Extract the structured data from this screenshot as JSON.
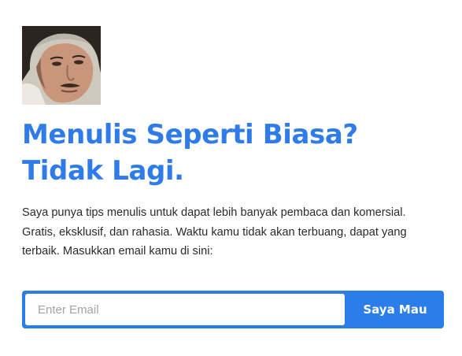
{
  "profile": {
    "photo_icon": "portrait-photo"
  },
  "headline": {
    "line1": "Menulis Seperti Biasa?",
    "line2": "Tidak Lagi."
  },
  "description": {
    "line1": "Saya punya tips menulis untuk dapat lebih banyak pembaca dan komersial.",
    "line2": "Gratis, eksklusif, dan rahasia. Waktu kamu tidak akan terbuang, dapat yang",
    "line3": "terbaik. Masukkan email kamu di sini:"
  },
  "form": {
    "email_placeholder": "Enter Email",
    "email_value": "",
    "submit_label": "Saya Mau"
  },
  "colors": {
    "accent": "#2f7bea",
    "button": "#2b7de9",
    "text": "#2a2a2a",
    "background": "#ffffff"
  }
}
